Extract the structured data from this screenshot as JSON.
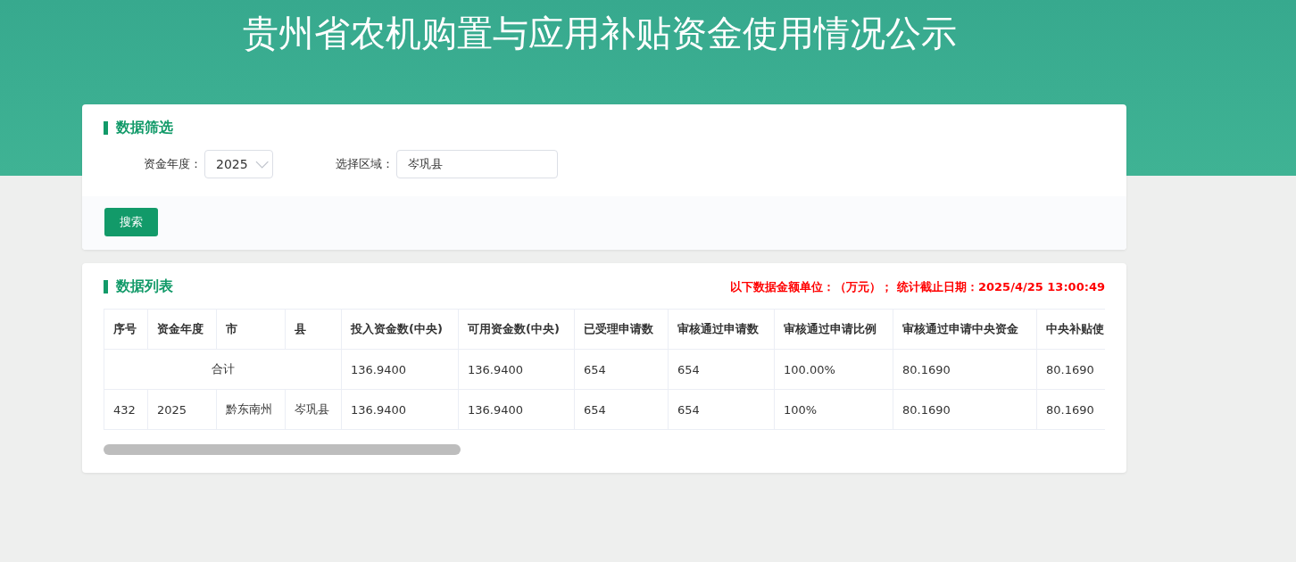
{
  "page_title": "贵州省农机购置与应用补贴资金使用情况公示",
  "filter": {
    "title": "数据筛选",
    "year_label": "资金年度：",
    "year_value": "2025",
    "region_label": "选择区域：",
    "region_value": "岑巩县",
    "search_button": "搜索"
  },
  "list": {
    "title": "数据列表",
    "notice": "以下数据金额单位：（万元）； 统计截止日期：2025/4/25 13:00:49",
    "columns": [
      "序号",
      "资金年度",
      "市",
      "县",
      "投入资金数(中央)",
      "可用资金数(中央)",
      "已受理申请数",
      "审核通过申请数",
      "审核通过申请比例",
      "审核通过申请中央资金",
      "中央补贴使"
    ],
    "rows": [
      {
        "kind": "total",
        "cells": [
          {
            "text": "合计",
            "colspan": 4
          },
          "136.9400",
          "136.9400",
          "654",
          "654",
          "100.00%",
          "80.1690",
          "80.1690"
        ]
      },
      {
        "kind": "data",
        "cells": [
          "432",
          "2025",
          "黔东南州",
          "岑巩县",
          "136.9400",
          "136.9400",
          "654",
          "654",
          "100%",
          "80.1690",
          "80.1690"
        ]
      }
    ]
  }
}
